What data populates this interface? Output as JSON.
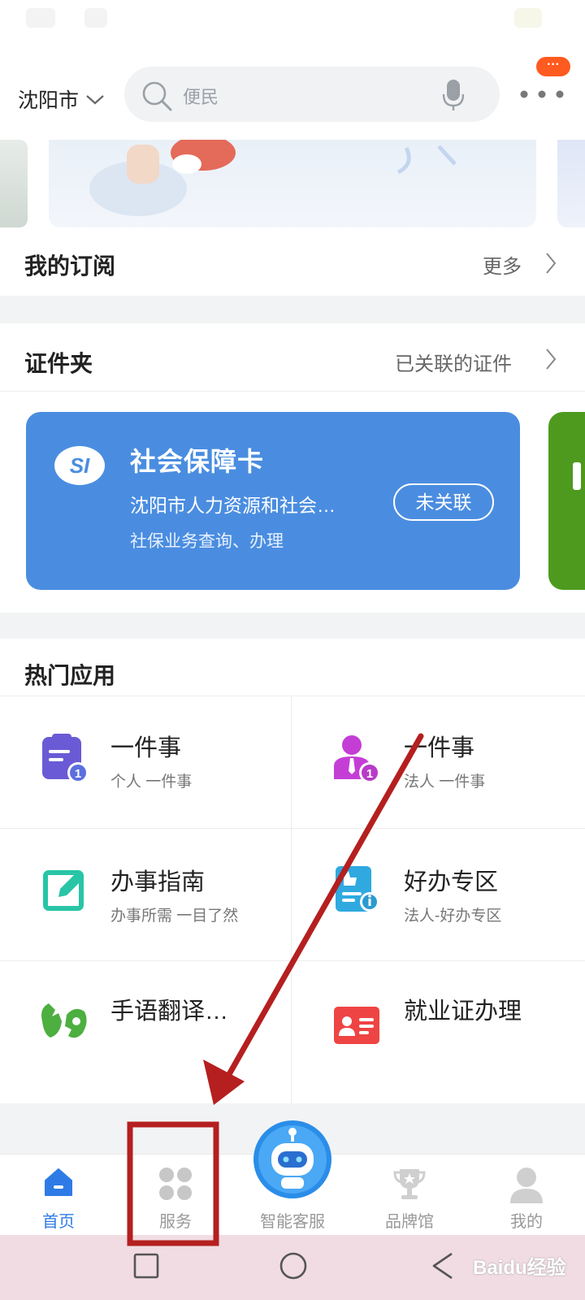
{
  "header": {
    "city": "沈阳市",
    "search_placeholder": "便民",
    "badge": "···"
  },
  "subscription": {
    "title": "我的订阅",
    "more": "更多"
  },
  "certificates": {
    "title": "证件夹",
    "more": "已关联的证件",
    "card": {
      "title": "社会保障卡",
      "org": "沈阳市人力资源和社会…",
      "desc": "社保业务查询、办理",
      "button": "未关联"
    }
  },
  "hot_apps": {
    "title": "热门应用",
    "items": [
      {
        "title": "一件事",
        "subtitle": "个人 一件事",
        "icon": "clipboard-person-icon",
        "color": "#6a5ad6"
      },
      {
        "title": "一件事",
        "subtitle": "法人 一件事",
        "icon": "business-person-icon",
        "color": "#c43ed6"
      },
      {
        "title": "办事指南",
        "subtitle": "办事所需 一目了然",
        "icon": "edit-note-icon",
        "color": "#28c5a6"
      },
      {
        "title": "好办专区",
        "subtitle": "法人-好办专区",
        "icon": "thumbs-up-doc-icon",
        "color": "#2fa9e0"
      },
      {
        "title": "手语翻译…",
        "subtitle": "",
        "icon": "sign-language-icon",
        "color": "#4caf3f"
      },
      {
        "title": "就业证办理",
        "subtitle": "",
        "icon": "id-card-icon",
        "color": "#ee4444"
      }
    ]
  },
  "bottom_nav": {
    "items": [
      {
        "label": "首页",
        "icon": "home-icon",
        "active": true
      },
      {
        "label": "服务",
        "icon": "grid-icon",
        "active": false
      },
      {
        "label": "智能客服",
        "icon": "robot-icon",
        "active": false
      },
      {
        "label": "品牌馆",
        "icon": "trophy-icon",
        "active": false
      },
      {
        "label": "我的",
        "icon": "user-icon",
        "active": false
      }
    ]
  },
  "watermark": "Baidu经验",
  "colors": {
    "accent": "#2f7be6",
    "card_blue": "#4a8de0",
    "annotation_red": "#b51f1f"
  }
}
